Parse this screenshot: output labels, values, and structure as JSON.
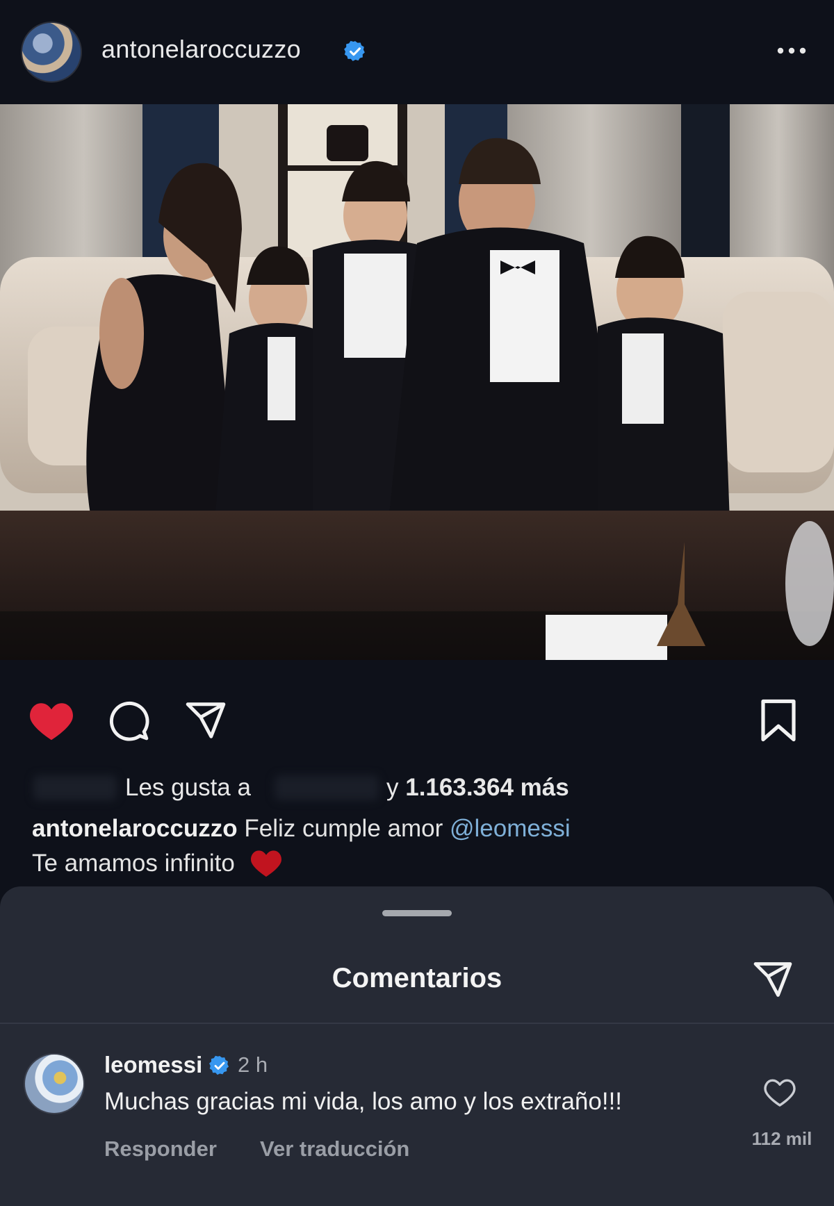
{
  "post": {
    "username": "antonelaroccuzzo",
    "likes_prefix": "Les gusta a",
    "likes_connector": "y",
    "likes_count": "1.163.364 más",
    "caption_user": "antonelaroccuzzo",
    "caption_text": "Feliz cumple amor",
    "caption_mention": "@leomessi",
    "caption_line2": "Te amamos infinito"
  },
  "comments_sheet": {
    "title": "Comentarios",
    "comment": {
      "username": "leomessi",
      "time": "2 h",
      "text": "Muchas gracias mi vida, los amo y los extraño!!!",
      "reply_label": "Responder",
      "translate_label": "Ver traducción",
      "like_count": "112 mil"
    }
  },
  "icons": {
    "liked": "heart-filled-icon",
    "comment": "comment-bubble-icon",
    "share": "paper-plane-icon",
    "save": "bookmark-icon",
    "more": "ellipsis-icon",
    "verified": "verified-badge-icon"
  },
  "colors": {
    "background": "#0e111a",
    "sheet": "#262a35",
    "like_red": "#e0243a",
    "mention": "#7fb0d8",
    "verified_blue": "#3797f0"
  }
}
